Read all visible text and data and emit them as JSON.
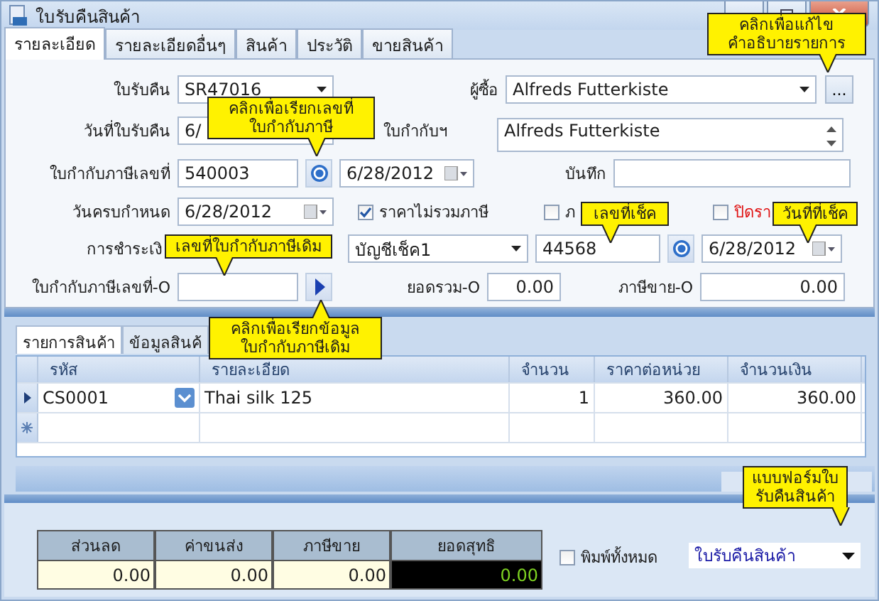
{
  "window": {
    "title": "ใบรับคืนสินค้า"
  },
  "tabs": [
    {
      "label": "รายละเอียด",
      "selected": true
    },
    {
      "label": "รายละเอียดอื่นๆ",
      "selected": false
    },
    {
      "label": "สินค้า",
      "selected": false
    },
    {
      "label": "ประวัติ",
      "selected": false
    },
    {
      "label": "ขายสินค้า",
      "selected": false
    }
  ],
  "form": {
    "return_no": {
      "label": "ใบรับคืน",
      "value": "SR47016"
    },
    "buyer": {
      "label": "ผู้ซื้อ",
      "value": "Alfreds Futterkiste",
      "address": "Alfreds Futterkiste",
      "more_button": "..."
    },
    "return_date": {
      "label": "วันที่ใบรับคืน",
      "value": "6/"
    },
    "invoice_ref_label": "ใบกำกับฯ",
    "invoice_no": {
      "label": "ใบกำกับภาษีเลขที่",
      "value": "540003",
      "date": "6/28/2012"
    },
    "memo": {
      "label": "บันทึก"
    },
    "due_date": {
      "label": "วันครบกำหนด",
      "value": "6/28/2012"
    },
    "checkboxes": [
      {
        "label": "ราคาไม่รวมภาษี",
        "checked": true,
        "kind": "normal"
      },
      {
        "label": "ภ",
        "checked": false,
        "kind": "normal"
      },
      {
        "label": "ปิดรา",
        "checked": false,
        "kind": "warning"
      }
    ],
    "payment": {
      "label": "การชำระเงิ",
      "account": "บัญชีเช็ค1",
      "cheque_no": "44568",
      "cheque_date": "6/28/2012"
    },
    "orig_invoice": {
      "label": "ใบกำกับภาษีเลขที่-O"
    },
    "total_o": {
      "label": "ยอดรวม-O",
      "value": "0.00"
    },
    "tax_o": {
      "label": "ภาษีขาย-O",
      "value": "0.00"
    }
  },
  "sub_tabs": [
    {
      "label": "รายการสินค้า",
      "selected": true
    },
    {
      "label": "ข้อมูลสินค้",
      "selected": false
    }
  ],
  "table": {
    "columns": [
      "รหัส",
      "รายละเอียด",
      "จำนวน",
      "ราคาต่อหน่วย",
      "จำนวนเงิน"
    ],
    "rows": [
      {
        "cells": [
          "CS0001",
          "Thai silk 125",
          "1",
          "360.00",
          "360.00"
        ],
        "selected": true
      }
    ]
  },
  "summary": {
    "columns": [
      "ส่วนลด",
      "ค่าขนส่ง",
      "ภาษีขาย",
      "ยอดสุทธิ"
    ],
    "values": [
      "0.00",
      "0.00",
      "0.00",
      "0.00"
    ]
  },
  "print_all": {
    "label": "พิมพ์ทั้งหมด",
    "checked": false
  },
  "form_select": {
    "value": "ใบรับคืนสินค้า"
  },
  "callouts": [
    {
      "lines": [
        "คลิกเพื่อแก้ไข",
        "คำอธิบายรายการ"
      ]
    },
    {
      "lines": [
        "คลิกเพื่อเรียกเลขที่",
        "ใบกำกับภาษี"
      ]
    },
    {
      "lines": [
        "เลขที่ใบกำกับภาษีเดิม"
      ]
    },
    {
      "lines": [
        "เลขที่เช็ค"
      ]
    },
    {
      "lines": [
        "วันที่ที่เช็ค"
      ]
    },
    {
      "lines": [
        "คลิกเพื่อเรียกข้อมูล",
        "ใบกำกับภาษีเดิม"
      ]
    },
    {
      "lines": [
        "แบบฟอร์มใบ",
        "รับคืนสินค้า"
      ]
    }
  ]
}
